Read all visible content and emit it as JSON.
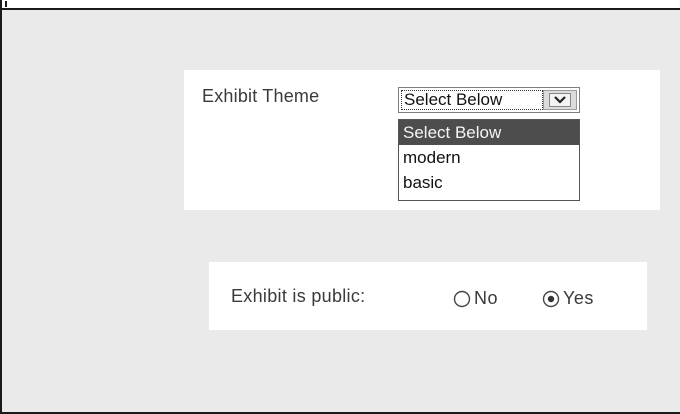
{
  "theme": {
    "label": "Exhibit Theme",
    "selected_value": "Select Below",
    "options": [
      "Select Below",
      "modern",
      "basic"
    ],
    "highlighted_option": "Select Below"
  },
  "visibility": {
    "label": "Exhibit is public:",
    "options": [
      {
        "label": "No",
        "checked": false
      },
      {
        "label": "Yes",
        "checked": true
      }
    ]
  },
  "icons": {
    "dropdown_arrow": "chevron-down-icon",
    "radio_unchecked": "radio-empty-icon",
    "radio_checked": "radio-dot-icon"
  },
  "colors": {
    "highlight_bg": "#4d4d4d",
    "panel_bg": "#ffffff",
    "page_bg": "#eaeaea"
  }
}
